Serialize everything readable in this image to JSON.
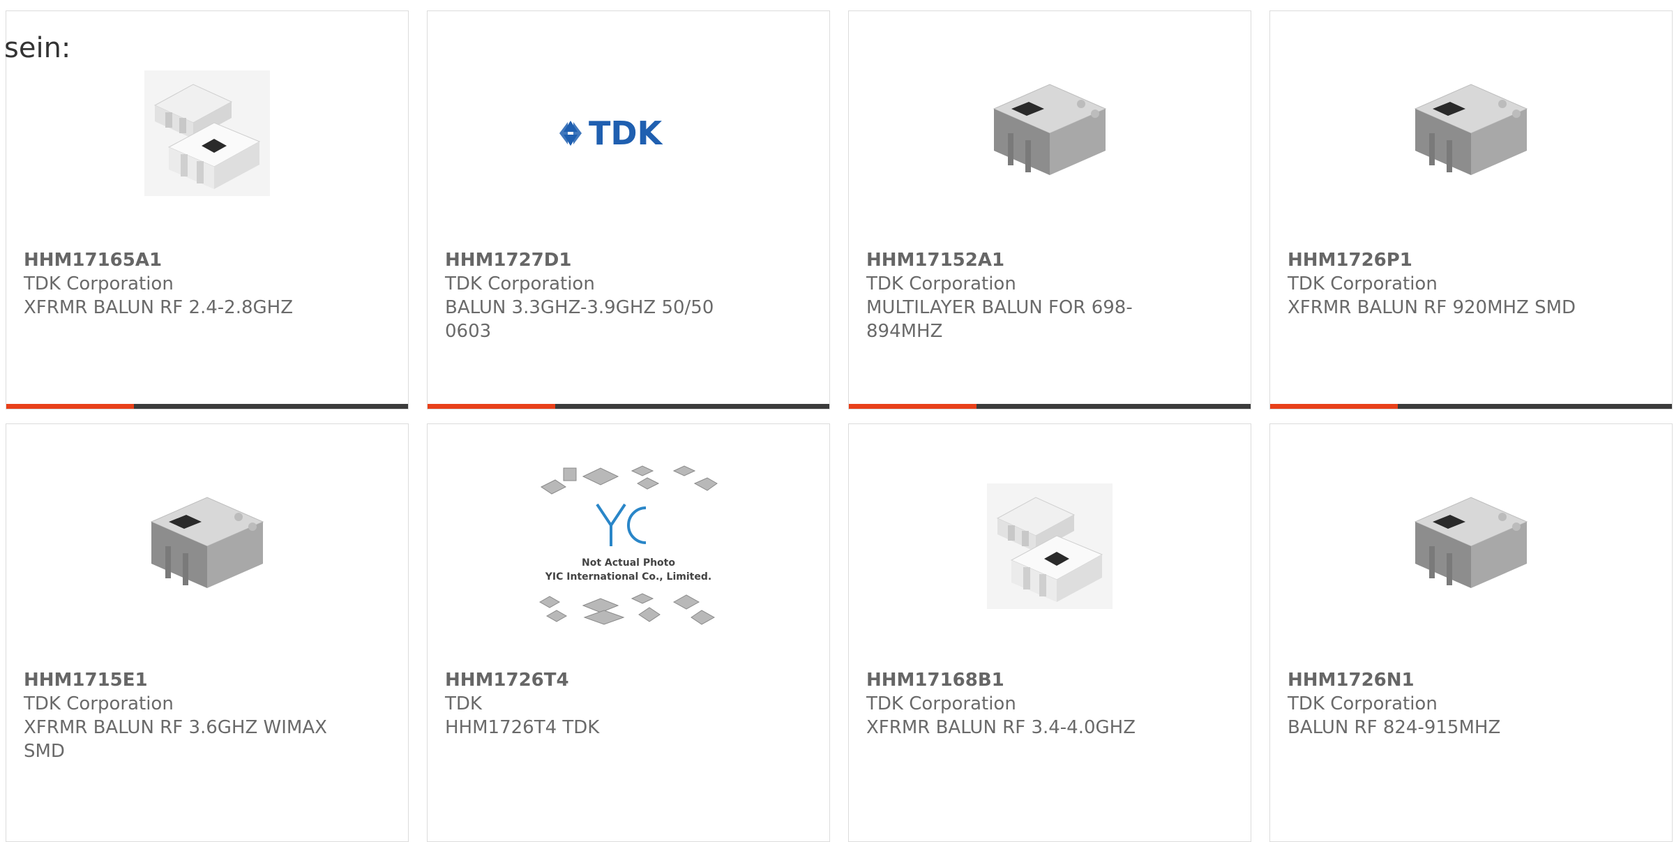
{
  "heading": "sein:",
  "colors": {
    "accent": "#e8401a",
    "bar": "#3b3b3b",
    "border": "#dcdcdc"
  },
  "products": [
    {
      "part": "HHM17165A1",
      "manufacturer": "TDK Corporation",
      "description": "XFRMR BALUN RF 2.4-2.8GHZ",
      "image": "balun-pair-white"
    },
    {
      "part": "HHM1727D1",
      "manufacturer": "TDK Corporation",
      "description": "BALUN 3.3GHZ-3.9GHZ 50/50 0603",
      "image": "tdk-logo",
      "logo_text": "TDK"
    },
    {
      "part": "HHM17152A1",
      "manufacturer": "TDK Corporation",
      "description": "MULTILAYER BALUN FOR 698-894MHZ",
      "image": "balun-gray"
    },
    {
      "part": "HHM1726P1",
      "manufacturer": "TDK Corporation",
      "description": "XFRMR BALUN RF 920MHZ SMD",
      "image": "balun-gray"
    },
    {
      "part": "HHM1715E1",
      "manufacturer": "TDK Corporation",
      "description": "XFRMR BALUN RF 3.6GHZ WIMAX SMD",
      "image": "balun-gray"
    },
    {
      "part": "HHM1726T4",
      "manufacturer": "TDK",
      "description": "HHM1726T4 TDK",
      "image": "yic-placeholder",
      "placeholder_line1": "Not Actual Photo",
      "placeholder_line2": "YIC International Co., Limited."
    },
    {
      "part": "HHM17168B1",
      "manufacturer": "TDK Corporation",
      "description": "XFRMR BALUN RF 3.4-4.0GHZ",
      "image": "balun-pair-white"
    },
    {
      "part": "HHM1726N1",
      "manufacturer": "TDK Corporation",
      "description": "BALUN RF 824-915MHZ",
      "image": "balun-gray"
    }
  ]
}
